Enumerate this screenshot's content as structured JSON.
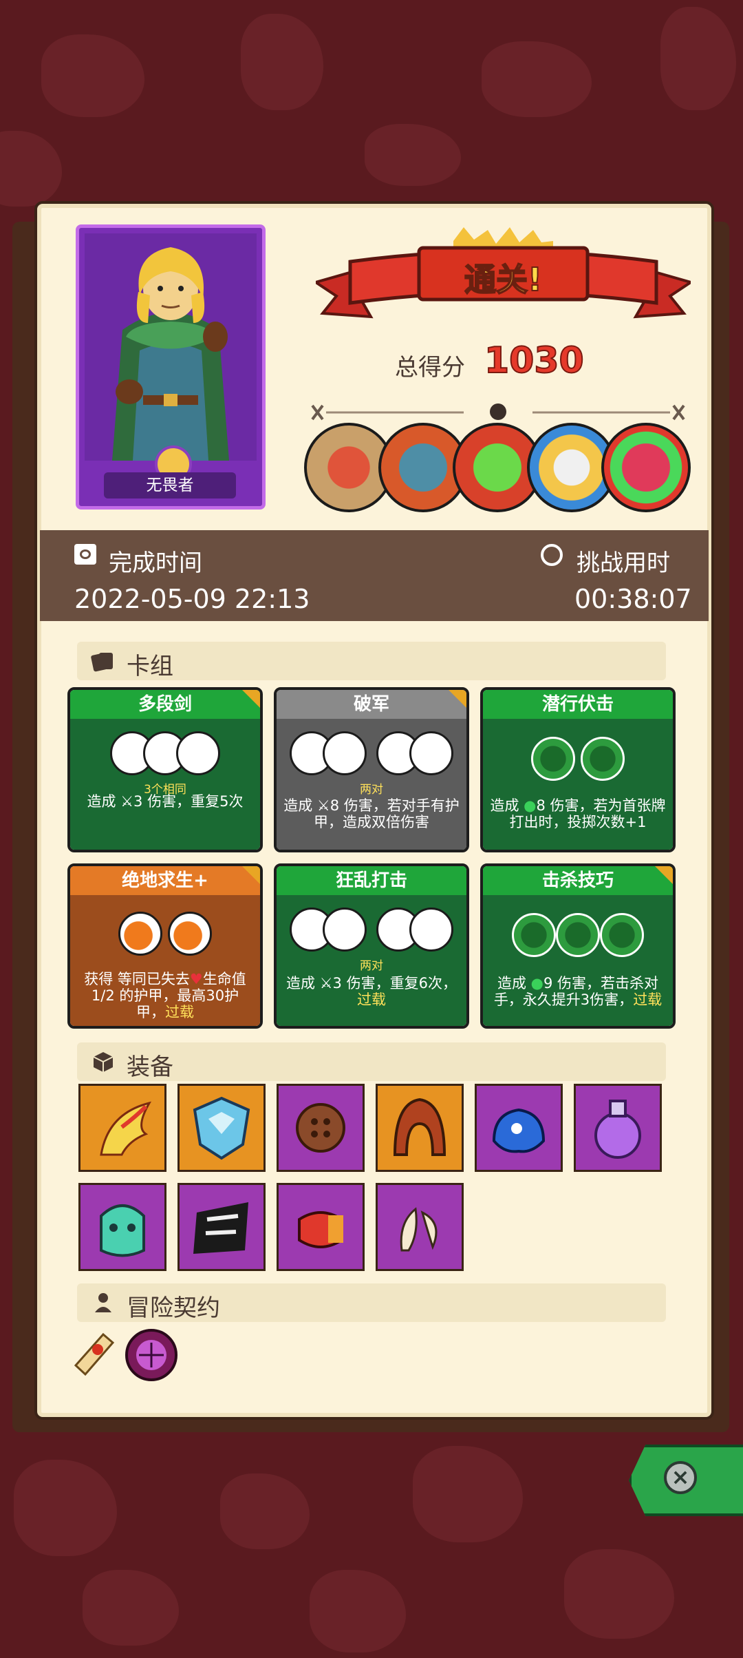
{
  "result": {
    "banner": "通关!",
    "score_label": "总得分",
    "score_value": "1030"
  },
  "hero": {
    "name": "无畏者"
  },
  "bosses": [
    "boss-1",
    "boss-2",
    "boss-3",
    "boss-4",
    "boss-5"
  ],
  "time": {
    "finish_label": "完成时间",
    "finish_value": "2022-05-09 22:13",
    "duration_label": "挑战用时",
    "duration_value": "00:38:07"
  },
  "sections": {
    "deck": "卡组",
    "equipment": "装备",
    "contract": "冒险契约"
  },
  "cards": [
    {
      "title": "多段剑",
      "hint": "3个相同",
      "desc_pre": "造成 ",
      "desc_mid": "3 伤害，重复5次",
      "kw": ""
    },
    {
      "title": "破军",
      "hint": "两对",
      "desc_pre": "造成 ",
      "desc_mid": "8 伤害，若对手有护甲，造成双倍伤害",
      "kw": ""
    },
    {
      "title": "潜行伏击",
      "hint": "",
      "desc_pre": "造成 ",
      "desc_mid": "8 伤害，若为首张牌打出时，投掷次数+1",
      "kw": ""
    },
    {
      "title": "绝地求生+",
      "hint": "",
      "desc_pre": "获得 等同已失去",
      "desc_mid": "生命值1/2 的护甲，最高30护甲，",
      "kw": "过载"
    },
    {
      "title": "狂乱打击",
      "hint": "两对",
      "desc_pre": "造成 ",
      "desc_mid": "3 伤害，重复6次，",
      "kw": "过载"
    },
    {
      "title": "击杀技巧",
      "hint": "",
      "desc_pre": "造成 ",
      "desc_mid": "9 伤害，若击杀对手，永久提升3伤害，",
      "kw": "过载"
    }
  ],
  "equipment": [
    "fire-feather",
    "ice-shield",
    "wooden-button",
    "leather-hood",
    "blue-slime",
    "purple-potion",
    "green-helm",
    "shadow-rune",
    "fang-bracer",
    "bone-charm"
  ],
  "contracts": [
    "scroll",
    "purple-orb"
  ],
  "colors": {
    "background": "#5a1a1f",
    "panel": "#fcf3da",
    "score": "#e5392a",
    "accent_green": "#1fa63a"
  }
}
